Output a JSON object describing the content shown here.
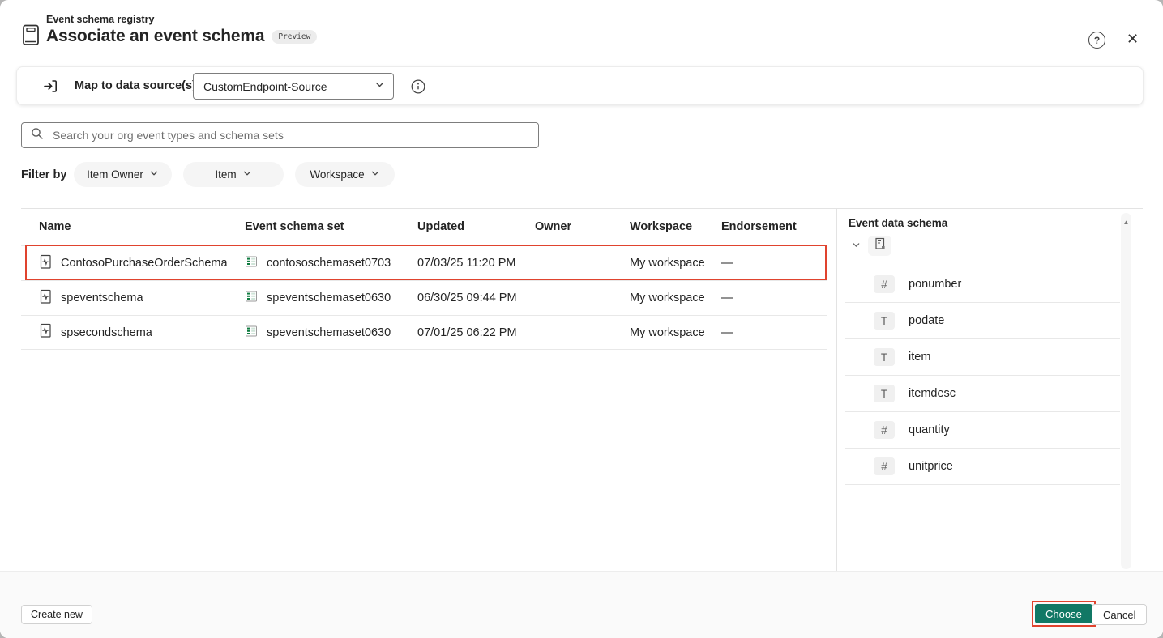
{
  "header": {
    "eyebrow": "Event schema registry",
    "title": "Associate an event schema",
    "preview_badge": "Preview"
  },
  "datasource": {
    "label": "Map to data source(s)",
    "required_mark": "*",
    "selected": "CustomEndpoint-Source"
  },
  "search": {
    "placeholder": "Search your org event types and schema sets"
  },
  "filters": {
    "label": "Filter by",
    "chips": [
      {
        "label": "Item Owner"
      },
      {
        "label": "Item"
      },
      {
        "label": "Workspace"
      }
    ]
  },
  "table": {
    "columns": [
      "Name",
      "Event schema set",
      "Updated",
      "Owner",
      "Workspace",
      "Endorsement"
    ],
    "rows": [
      {
        "name": "ContosoPurchaseOrderSchema",
        "schema_set": "contososchemaset0703",
        "updated": "07/03/25 11:20 PM",
        "owner": "",
        "workspace": "My workspace",
        "endorsement": "—",
        "selected": true
      },
      {
        "name": "speventschema",
        "schema_set": "speventschemaset0630",
        "updated": "06/30/25 09:44 PM",
        "owner": "",
        "workspace": "My workspace",
        "endorsement": "—",
        "selected": false
      },
      {
        "name": "spsecondschema",
        "schema_set": "speventschemaset0630",
        "updated": "07/01/25 06:22 PM",
        "owner": "",
        "workspace": "My workspace",
        "endorsement": "—",
        "selected": false
      }
    ]
  },
  "schema_panel": {
    "title": "Event data schema",
    "fields": [
      {
        "name": "ponumber",
        "type": "number",
        "icon_glyph": "#"
      },
      {
        "name": "podate",
        "type": "text",
        "icon_glyph": "T"
      },
      {
        "name": "item",
        "type": "text",
        "icon_glyph": "T"
      },
      {
        "name": "itemdesc",
        "type": "text",
        "icon_glyph": "T"
      },
      {
        "name": "quantity",
        "type": "number",
        "icon_glyph": "#"
      },
      {
        "name": "unitprice",
        "type": "number",
        "icon_glyph": "#"
      }
    ]
  },
  "footer": {
    "create_new": "Create new",
    "choose": "Choose",
    "cancel": "Cancel"
  },
  "icons": {
    "help": "?",
    "close": "✕",
    "scroll_up": "▲"
  },
  "colors": {
    "accent_teal": "#117865",
    "annotation_red": "#e0432e",
    "schema_set_green": "#107c41",
    "required_red": "#c50f1f"
  }
}
